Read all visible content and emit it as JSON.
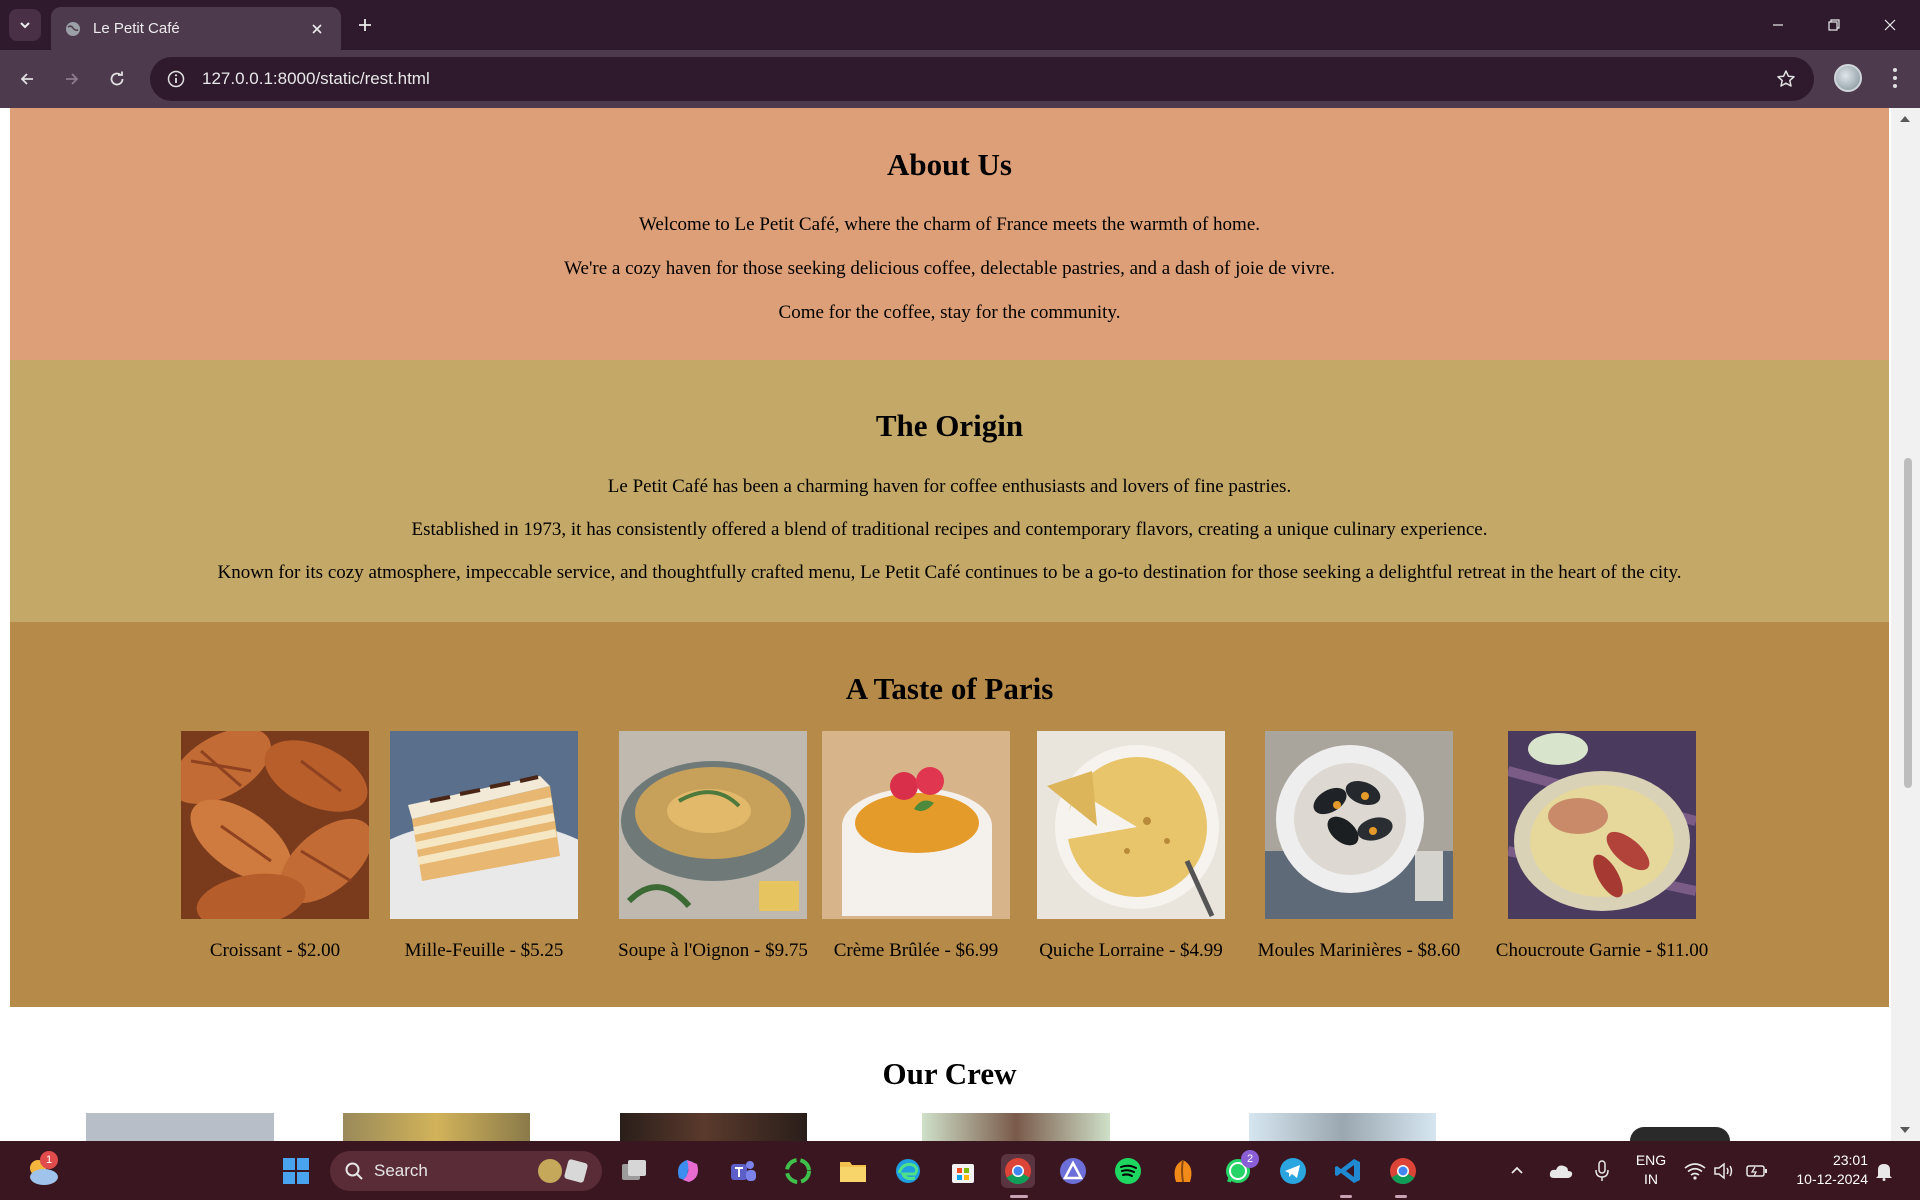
{
  "browser": {
    "tab_title": "Le Petit Café",
    "url": "127.0.0.1:8000/static/rest.html"
  },
  "about": {
    "title": "About Us",
    "paragraphs": [
      "Welcome to Le Petit Café, where the charm of France meets the warmth of home.",
      "We're a cozy haven for those seeking delicious coffee, delectable pastries, and a dash of joie de vivre.",
      "Come for the coffee, stay for the community."
    ],
    "bg_color": "#dc9f77"
  },
  "origin": {
    "title": "The Origin",
    "paragraphs": [
      "Le Petit Café has been a charming haven for coffee enthusiasts and lovers of fine pastries.",
      "Established in 1973, it has consistently offered a blend of traditional recipes and contemporary flavors, creating a unique culinary experience.",
      "Known for its cozy atmosphere, impeccable service, and thoughtfully crafted menu, Le Petit Café continues to be a go-to destination for those seeking a delightful retreat in the heart of the city."
    ],
    "bg_color": "#c4a868"
  },
  "taste": {
    "title": "A Taste of Paris",
    "bg_color": "#b68a48",
    "dishes": [
      "Croissant - $2.00",
      "Mille-Feuille - $5.25",
      "Soupe à l'Oignon - $9.75",
      "Crème Brûlée - $6.99",
      "Quiche Lorraine - $4.99",
      "Moules Marinières - $8.60",
      "Choucroute Garnie - $11.00"
    ]
  },
  "crew": {
    "title": "Our Crew"
  },
  "taskbar": {
    "search_label": "Search",
    "weather_badge": "1",
    "whatsapp_badge": "2",
    "language": "ENG",
    "region": "IN",
    "time": "23:01",
    "date": "10-12-2024"
  }
}
